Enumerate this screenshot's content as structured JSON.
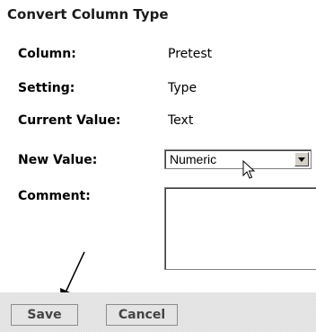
{
  "dialog": {
    "title": "Convert Column Type"
  },
  "fields": {
    "column": {
      "label": "Column:",
      "value": "Pretest"
    },
    "setting": {
      "label": "Setting:",
      "value": "Type"
    },
    "current_value": {
      "label": "Current Value:",
      "value": "Text"
    },
    "new_value": {
      "label": "New Value:",
      "selected": "Numeric"
    },
    "comment": {
      "label": "Comment:",
      "value": ""
    }
  },
  "buttons": {
    "save": "Save",
    "cancel": "Cancel"
  },
  "icons": {
    "select_arrow": "chevron-down-icon",
    "mouse_pointer": "mouse-pointer-icon",
    "annotation_arrow": "annotation-arrow-icon"
  },
  "colors": {
    "footer_bg": "#ebebeb",
    "button_bg": "#e4e4e4",
    "button_text": "#444444",
    "control_gray": "#d4d0c8"
  }
}
